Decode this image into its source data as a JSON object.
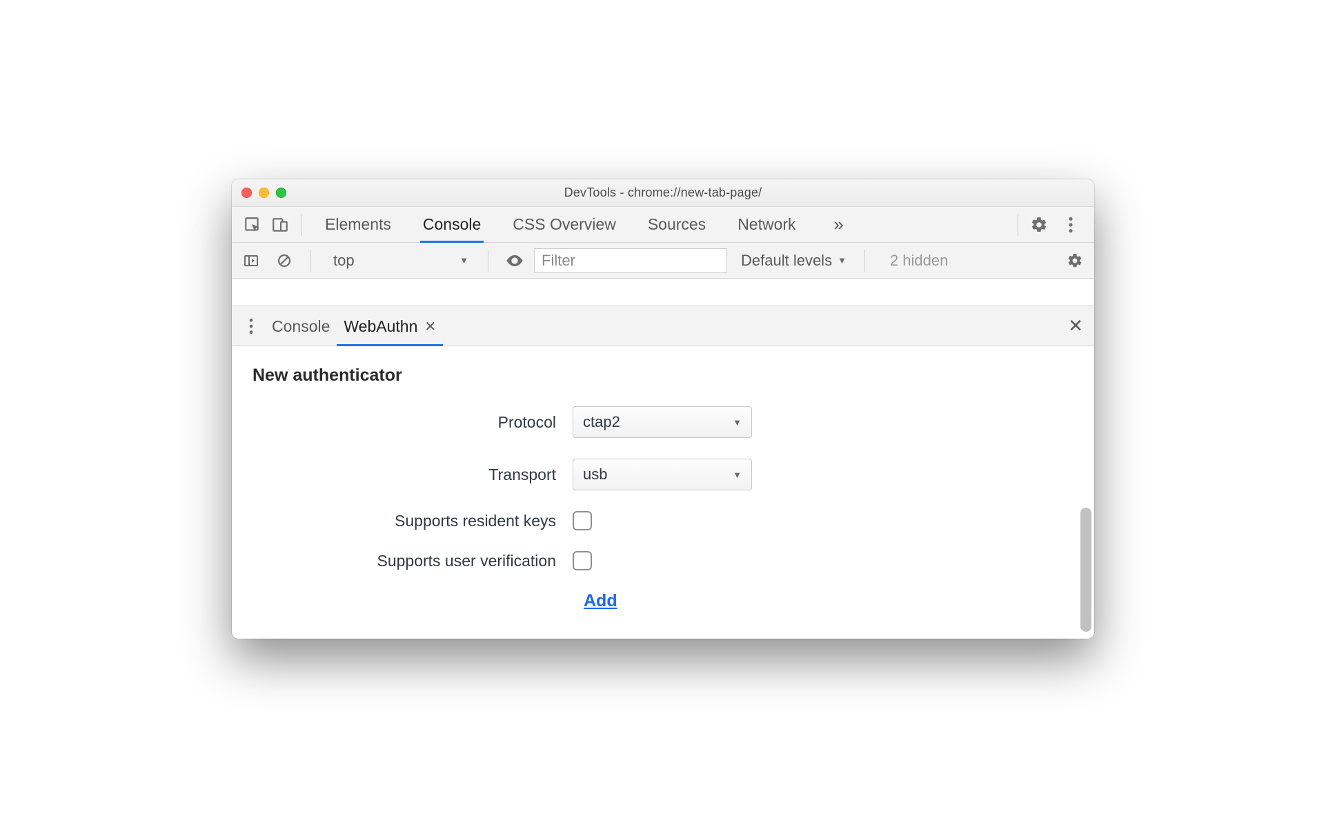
{
  "window": {
    "title": "DevTools - chrome://new-tab-page/"
  },
  "main_tabs": {
    "items": [
      "Elements",
      "Console",
      "CSS Overview",
      "Sources",
      "Network"
    ],
    "active_index": 1
  },
  "console_bar": {
    "context": "top",
    "filter_placeholder": "Filter",
    "levels_label": "Default levels",
    "hidden_label": "2 hidden"
  },
  "drawer": {
    "tabs": [
      "Console",
      "WebAuthn"
    ],
    "active_index": 1
  },
  "form": {
    "heading": "New authenticator",
    "protocol_label": "Protocol",
    "protocol_value": "ctap2",
    "transport_label": "Transport",
    "transport_value": "usb",
    "resident_label": "Supports resident keys",
    "userverif_label": "Supports user verification",
    "add_label": "Add"
  }
}
